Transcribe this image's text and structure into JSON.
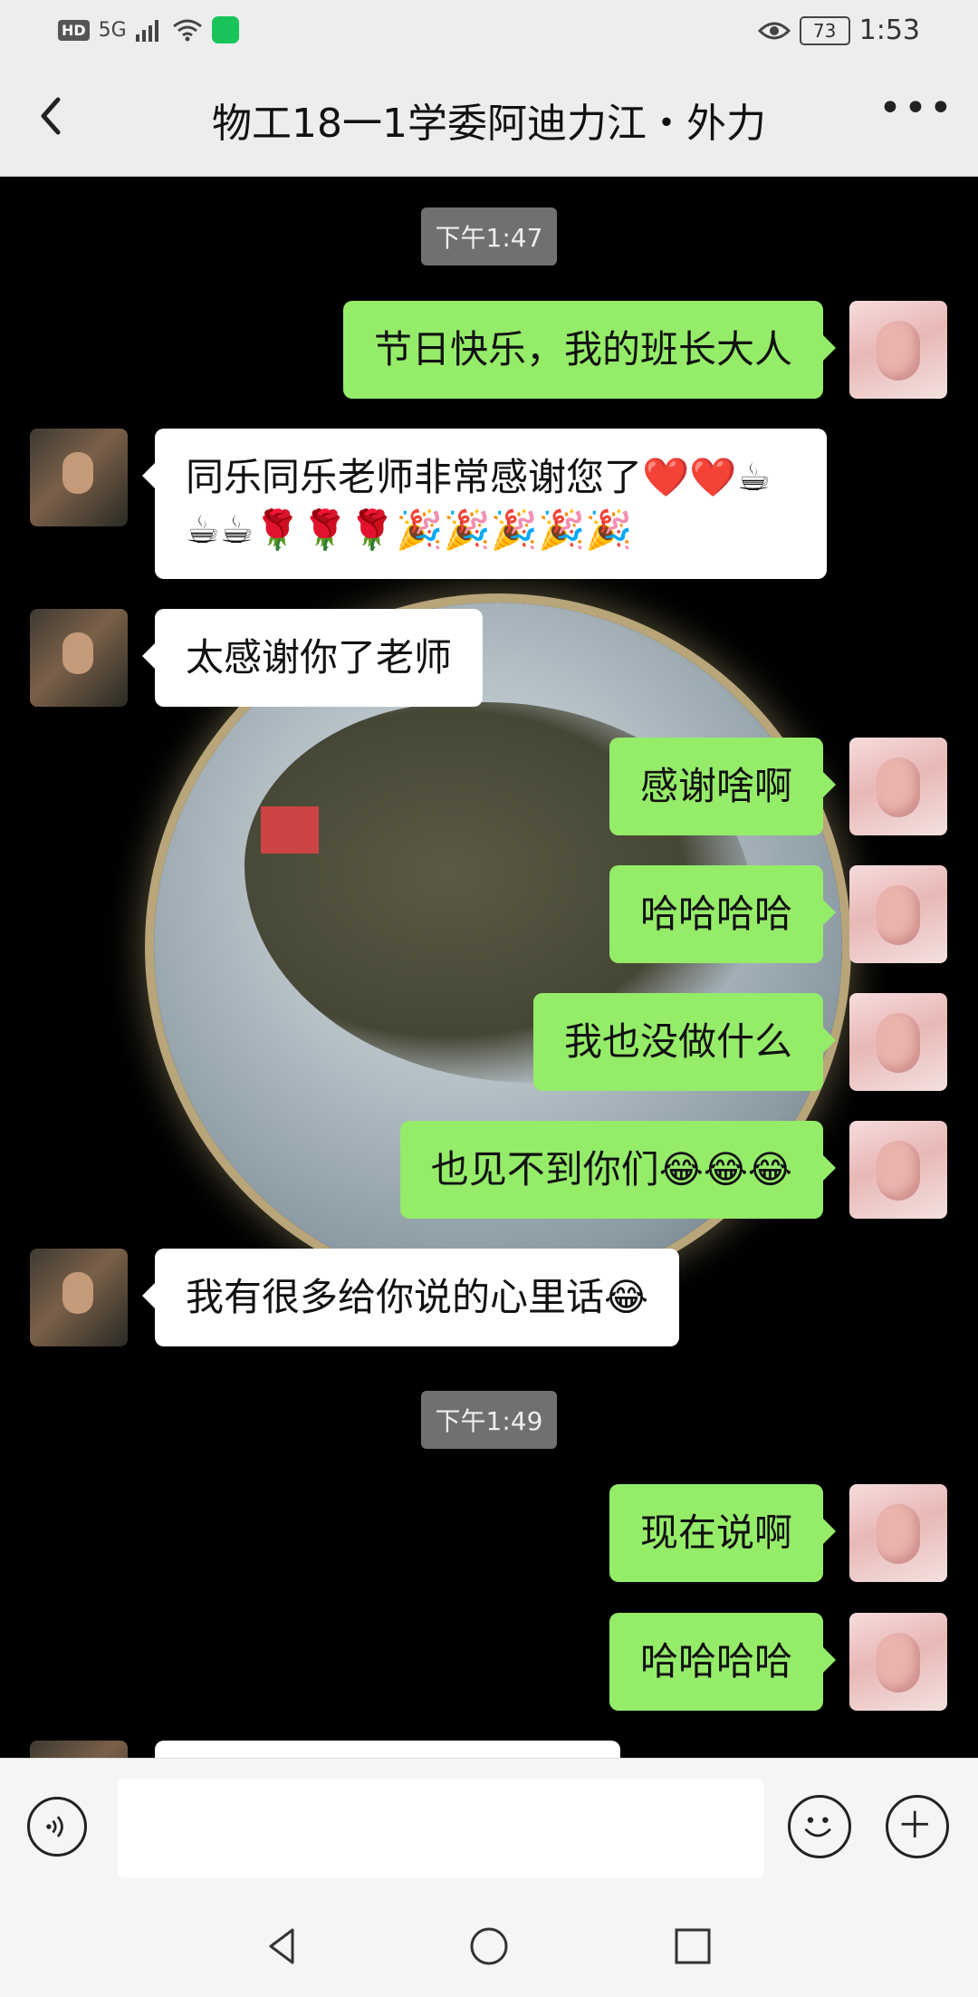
{
  "status_bar": {
    "hd": "HD",
    "network": "5G",
    "battery": "73",
    "time": "1:53"
  },
  "header": {
    "title": "物工18一1学委阿迪力江・外力",
    "back_icon": "chevron-left-icon",
    "more_icon": "more-dots-icon"
  },
  "messages": [
    {
      "type": "timestamp",
      "text": "下午1:47"
    },
    {
      "type": "msg",
      "side": "me",
      "text": "节日快乐，我的班长大人"
    },
    {
      "type": "msg",
      "side": "them",
      "text": "同乐同乐老师非常感谢您了❤️❤️☕☕☕🌹🌹🌹🎉🎉🎉🎉🎉"
    },
    {
      "type": "msg",
      "side": "them",
      "text": "太感谢你了老师"
    },
    {
      "type": "msg",
      "side": "me",
      "text": "感谢啥啊"
    },
    {
      "type": "msg",
      "side": "me",
      "text": "哈哈哈哈"
    },
    {
      "type": "msg",
      "side": "me",
      "text": "我也没做什么"
    },
    {
      "type": "msg",
      "side": "me",
      "text": "也见不到你们😂😂😂"
    },
    {
      "type": "msg",
      "side": "them",
      "text": "我有很多给你说的心里话😂"
    },
    {
      "type": "timestamp",
      "text": "下午1:49"
    },
    {
      "type": "msg",
      "side": "me",
      "text": "现在说啊"
    },
    {
      "type": "msg",
      "side": "me",
      "text": "哈哈哈哈"
    }
  ],
  "input_bar": {
    "voice_icon": "voice-icon",
    "emoji_icon": "emoji-icon",
    "plus_icon": "plus-icon",
    "placeholder": ""
  },
  "nav": {
    "back": "nav-back-icon",
    "home": "nav-home-icon",
    "recents": "nav-recents-icon"
  }
}
